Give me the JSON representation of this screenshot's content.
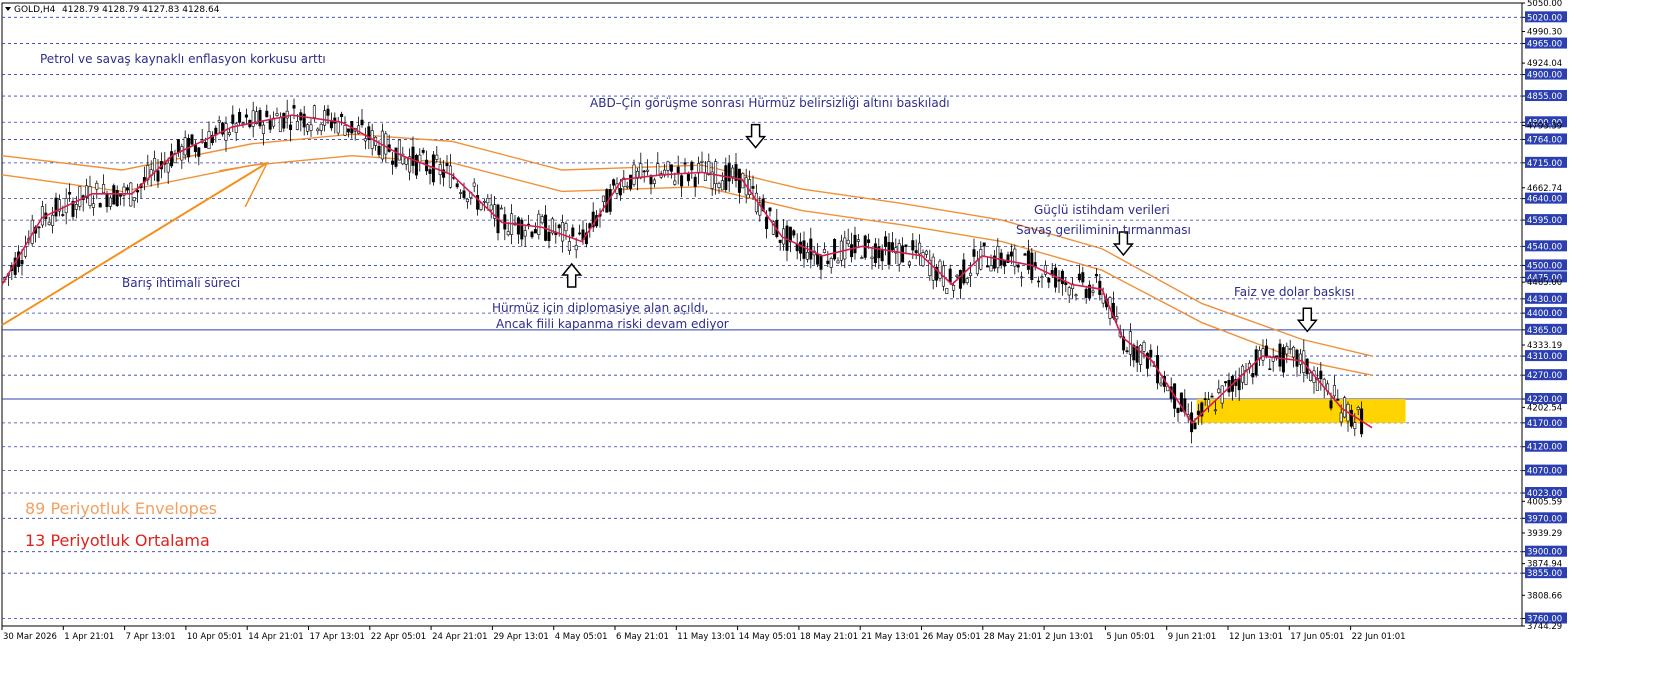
{
  "header": {
    "symbol": "GOLD,H4",
    "ohlc": "4128.79 4128.79 4127.83 4128.64"
  },
  "colors": {
    "envelope": "#f0913a",
    "ma13": "#d81b4f",
    "candles": "#000000",
    "highlight_zone": "#ffd400",
    "grid_levels": "#2b3fb0",
    "trendline": "#f4901e",
    "annotation_text": "#2d2d8a",
    "legend_envelope": "#f0a060",
    "legend_ma": "#e0201c"
  },
  "legend": {
    "envelope": "89 Periyotluk Envelopes",
    "ma": "13 Periyotluk Ortalama"
  },
  "annotations": {
    "a1": "Petrol ve savaş kaynaklı enflasyon korkusu arttı",
    "a2": "ABD–Çin görüşme sonrası Hürmüz belirsizliği altını baskıladı",
    "a3": "Barış ihtimali süreci",
    "a4a": "Hürmüz için diplomasiye alan açıldı,",
    "a4b": "Ancak fiili kapanma riski devam ediyor",
    "a5a": "Güçlü istihdam verileri",
    "a5b": "Savaş geriliminin tırmanması",
    "a6": "Faiz ve dolar baskısı"
  },
  "chart_data": {
    "type": "line",
    "instrument": "GOLD",
    "timeframe": "H4",
    "ylim": [
      3744.29,
      5050
    ],
    "y_tick_labels": [
      "5050.00",
      "5020.00",
      "4990.30",
      "4965.00",
      "4924.04",
      "4900.00",
      "4855.00",
      "4800.00",
      "4793.39",
      "4764.00",
      "4715.00",
      "4662.74",
      "4640.00",
      "4595.00",
      "4540.00",
      "4500.00",
      "4475.00",
      "4465.00",
      "4430.00",
      "4400.00",
      "4365.00",
      "4333.19",
      "4310.00",
      "4270.00",
      "4220.00",
      "4202.54",
      "4170.00",
      "4120.00",
      "4070.00",
      "4023.00",
      "4005.59",
      "3970.00",
      "3939.29",
      "3900.00",
      "3874.94",
      "3855.00",
      "3808.66",
      "3760.00",
      "3744.29"
    ],
    "x_tick_labels": [
      "30 Mar 2026",
      "1 Apr 21:01",
      "7 Apr 13:01",
      "10 Apr 05:01",
      "14 Apr 21:01",
      "17 Apr 13:01",
      "22 Apr 05:01",
      "24 Apr 21:01",
      "29 Apr 13:01",
      "4 May 05:01",
      "6 May 21:01",
      "11 May 13:01",
      "14 May 05:01",
      "18 May 21:01",
      "21 May 13:01",
      "26 May 05:01",
      "28 May 21:01",
      "2 Jun 13:01",
      "5 Jun 05:01",
      "9 Jun 21:01",
      "12 Jun 13:01",
      "17 Jun 05:01",
      "22 Jun 01:01"
    ],
    "horizontal_levels": [
      5020,
      4965,
      4900,
      4855,
      4800,
      4764,
      4715,
      4640,
      4595,
      4540,
      4500,
      4475,
      4430,
      4400,
      4310,
      4270,
      4170,
      4120,
      4070,
      4023,
      3970,
      3900,
      3855,
      3760
    ],
    "solid_levels": [
      4365,
      4220
    ],
    "highlight_zone": {
      "from": 4170,
      "to": 4220,
      "x_start": "9 Jun 21:01",
      "x_end": "22 Jun 01:01"
    },
    "trendline": {
      "from": [
        "30 Mar 2026",
        4375
      ],
      "to": [
        "14 Apr 21:01",
        4715
      ]
    },
    "series": [
      {
        "name": "13 Periyotluk Ortalama",
        "points": [
          [
            0,
            4460
          ],
          [
            40,
            4600
          ],
          [
            90,
            4650
          ],
          [
            130,
            4650
          ],
          [
            170,
            4730
          ],
          [
            230,
            4790
          ],
          [
            290,
            4815
          ],
          [
            340,
            4800
          ],
          [
            400,
            4730
          ],
          [
            450,
            4690
          ],
          [
            500,
            4590
          ],
          [
            540,
            4580
          ],
          [
            580,
            4550
          ],
          [
            620,
            4680
          ],
          [
            660,
            4690
          ],
          [
            700,
            4695
          ],
          [
            740,
            4680
          ],
          [
            780,
            4560
          ],
          [
            820,
            4520
          ],
          [
            860,
            4540
          ],
          [
            920,
            4520
          ],
          [
            950,
            4460
          ],
          [
            980,
            4520
          ],
          [
            1030,
            4500
          ],
          [
            1070,
            4460
          ],
          [
            1100,
            4450
          ],
          [
            1120,
            4350
          ],
          [
            1150,
            4300
          ],
          [
            1190,
            4170
          ],
          [
            1230,
            4250
          ],
          [
            1260,
            4310
          ],
          [
            1300,
            4300
          ],
          [
            1340,
            4200
          ],
          [
            1370,
            4160
          ]
        ]
      },
      {
        "name": "89 Periyotluk Envelopes",
        "band": "upper",
        "points": [
          [
            0,
            4730
          ],
          [
            120,
            4700
          ],
          [
            250,
            4755
          ],
          [
            350,
            4775
          ],
          [
            450,
            4760
          ],
          [
            560,
            4700
          ],
          [
            700,
            4710
          ],
          [
            800,
            4660
          ],
          [
            900,
            4630
          ],
          [
            1000,
            4595
          ],
          [
            1100,
            4535
          ],
          [
            1200,
            4420
          ],
          [
            1300,
            4345
          ],
          [
            1370,
            4310
          ]
        ]
      },
      {
        "name": "89 Periyotluk Envelopes",
        "band": "lower",
        "points": [
          [
            0,
            4690
          ],
          [
            120,
            4655
          ],
          [
            250,
            4710
          ],
          [
            350,
            4730
          ],
          [
            450,
            4715
          ],
          [
            560,
            4655
          ],
          [
            700,
            4665
          ],
          [
            800,
            4615
          ],
          [
            900,
            4585
          ],
          [
            1000,
            4550
          ],
          [
            1100,
            4490
          ],
          [
            1200,
            4380
          ],
          [
            1300,
            4300
          ],
          [
            1370,
            4270
          ]
        ]
      }
    ],
    "arrows": [
      {
        "direction": "down",
        "at": [
          "14 May 05:01",
          4770
        ]
      },
      {
        "direction": "up",
        "at": [
          "4 May 05:01",
          4480
        ]
      },
      {
        "direction": "down",
        "at": [
          "5 Jun 05:01",
          4545
        ]
      },
      {
        "direction": "down",
        "at": [
          "17 Jun 05:01",
          4385
        ]
      }
    ]
  }
}
